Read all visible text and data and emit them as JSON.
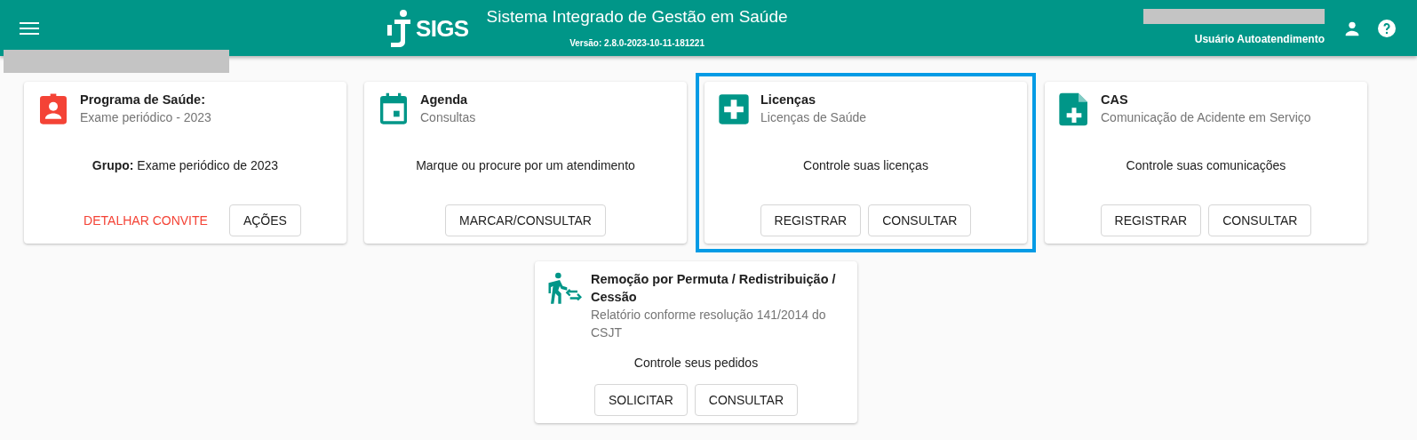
{
  "header": {
    "title": "Sistema Integrado de Gestão em Saúde",
    "logo_text": "SIGS",
    "version": "Versão: 2.8.0-2023-10-11-181221",
    "user": "Usuário Autoatendimento"
  },
  "cards": [
    {
      "kind": "badge",
      "color": "#f44336",
      "title": "Programa de Saúde:",
      "subtitle": "Exame periódico - 2023",
      "text": "**Grupo:** Exame periódico de 2023",
      "highlighted": false,
      "buttons": [
        {
          "label": "DETALHAR CONVITE",
          "kind": "text"
        },
        {
          "label": "AÇÕES",
          "kind": "outlined"
        }
      ]
    },
    {
      "kind": "calendar",
      "color": "#009688",
      "title": "Agenda",
      "subtitle": "Consultas",
      "text": "Marque ou procure por um atendimento",
      "highlighted": false,
      "buttons": [
        {
          "label": "MARCAR/CONSULTAR",
          "kind": "outlined"
        }
      ]
    },
    {
      "kind": "plus-box",
      "color": "#009688",
      "title": "Licenças",
      "subtitle": "Licenças de Saúde",
      "text": "Controle suas licenças",
      "highlighted": true,
      "buttons": [
        {
          "label": "REGISTRAR",
          "kind": "outlined"
        },
        {
          "label": "CONSULTAR",
          "kind": "outlined"
        }
      ]
    },
    {
      "kind": "file-plus",
      "color": "#009688",
      "title": "CAS",
      "subtitle": "Comunicação de Acidente em Serviço",
      "text": "Controle suas comunicações",
      "highlighted": false,
      "buttons": [
        {
          "label": "REGISTRAR",
          "kind": "outlined"
        },
        {
          "label": "CONSULTAR",
          "kind": "outlined"
        }
      ]
    },
    {
      "kind": "walk-exchange",
      "color": "#009688",
      "title": "Remoção por Permuta / Redistribuição / Cessão",
      "subtitle": "Relatório conforme resolução 141/2014 do CSJT",
      "text": "Controle seus pedidos",
      "highlighted": false,
      "buttons": [
        {
          "label": "SOLICITAR",
          "kind": "outlined"
        },
        {
          "label": "CONSULTAR",
          "kind": "outlined"
        }
      ]
    }
  ]
}
